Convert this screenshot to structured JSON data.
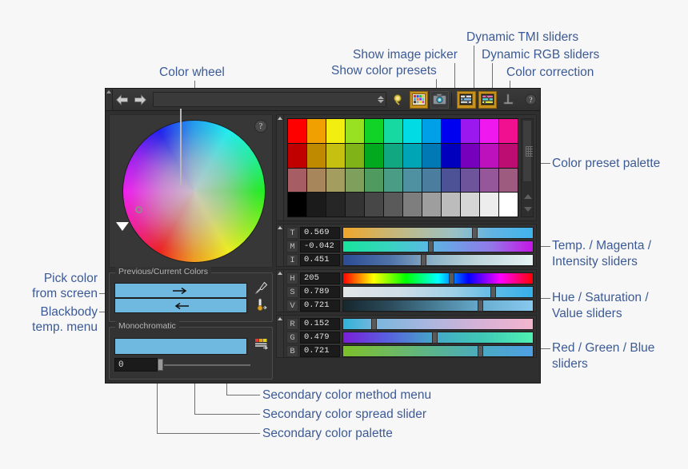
{
  "annotations": {
    "color_wheel": "Color wheel",
    "show_color_presets": "Show color presets",
    "show_image_picker": "Show image picker",
    "dynamic_tmi_sliders": "Dynamic TMI sliders",
    "dynamic_rgb_sliders": "Dynamic RGB sliders",
    "color_correction": "Color correction",
    "color_preset_palette": "Color preset palette",
    "tmi_line1": "Temp. / Magenta /",
    "tmi_line2": "Intensity sliders",
    "hsv_line1": "Hue / Saturation /",
    "hsv_line2": "Value sliders",
    "rgb_line1": "Red / Green / Blue",
    "rgb_line2": "sliders",
    "pick_color_line1": "Pick color",
    "pick_color_line2": "from screen",
    "blackbody_line1": "Blackbody",
    "blackbody_line2": "temp. menu",
    "secondary_method_menu": "Secondary color method menu",
    "secondary_spread_slider": "Secondary color spread slider",
    "secondary_palette": "Secondary color palette"
  },
  "toolbar": {
    "back_icon": "left-arrow-icon",
    "forward_icon": "right-arrow-icon",
    "field_value": "",
    "field_placeholder": "",
    "blackbody_icon": "blackbody-temp-icon",
    "presets_icon": "color-presets-icon",
    "image_picker_icon": "image-picker-icon",
    "tmi_icon": "dynamic-tmi-sliders-icon",
    "rgb_icon": "dynamic-rgb-sliders-icon",
    "correction_icon": "color-correction-icon",
    "help_icon": "help-icon"
  },
  "wheel": {
    "help_label": "?"
  },
  "panels": {
    "previous_current_title": "Previous/Current Colors",
    "monochromatic_title": "Monochromatic",
    "previous_color": "#6fb8e0",
    "current_color": "#6fb8e0",
    "mono_color": "#6fb8e0",
    "spread_value": "0",
    "eyedropper_icon": "eyedropper-icon",
    "thermometer_icon": "thermometer-icon",
    "method_menu_icon": "secondary-color-method-icon"
  },
  "palette": {
    "rows": [
      [
        "#ff0000",
        "#f0a000",
        "#f2ee10",
        "#97e022",
        "#11d227",
        "#15d9a0",
        "#00dbe4",
        "#00a0e8",
        "#0000f0",
        "#9b18ee",
        "#ef18ef",
        "#f01090"
      ],
      [
        "#c00000",
        "#c08a00",
        "#c6c010",
        "#7fb318",
        "#02a81e",
        "#11a881",
        "#00a5b5",
        "#0079b4",
        "#0000bd",
        "#7600bc",
        "#bc11bc",
        "#bd0d73"
      ],
      [
        "#a65e64",
        "#a8865c",
        "#a39e5f",
        "#7fa05d",
        "#4f9a5f",
        "#4b9c85",
        "#4f90a1",
        "#4a7d9e",
        "#4d5296",
        "#6e549a",
        "#96569a",
        "#9c5b7f"
      ],
      [
        "#000000",
        "#1b1b1b",
        "#262626",
        "#343434",
        "#474747",
        "#5a5a5a",
        "#7e7e7e",
        "#9e9e9e",
        "#bcbcbc",
        "#d6d6d6",
        "#ededed",
        "#ffffff"
      ]
    ]
  },
  "sliders": {
    "tmi": [
      {
        "label": "T",
        "value": "0.569",
        "pos": 69,
        "grad": "linear-gradient(90deg,#f0a629 0%,#cdb56d 22%,#b4bd9c 40%,#9cc0c3 58%,#63b4e2 78%,#40b4ec 100%)"
      },
      {
        "label": "M",
        "value": "-0.042",
        "pos": 46,
        "grad": "linear-gradient(90deg,#19e39c 0%,#34d6bb 22%,#56bde0 42%,#6e9fe6 58%,#9278e8 78%,#c616e6 100%)"
      },
      {
        "label": "I",
        "value": "0.451",
        "pos": 42,
        "grad": "linear-gradient(90deg,#2c4c94 0%,#4f73a8 25%,#8fb3c6 48%,#bdd5da 70%,#e6f4f4 100%)"
      }
    ],
    "hsv": [
      {
        "label": "H",
        "value": "205",
        "pos": 57,
        "grad": "linear-gradient(90deg,#ff0000 0%,#ffff00 16%,#00ff00 33%,#00ffff 50%,#0000ff 66%,#ff00ff 83%,#ff0000 100%)"
      },
      {
        "label": "S",
        "value": "0.789",
        "pos": 79,
        "grad": "linear-gradient(90deg,#e2e6e8 0%,#cfdde6 30%,#9ecfe6 58%,#5ebae6 80%,#36b0ea 100%)"
      },
      {
        "label": "V",
        "value": "0.721",
        "pos": 72,
        "grad": "linear-gradient(90deg,#16272e 0%,#2c4c5c 25%,#4a8099 50%,#6bb0d4 75%,#88c9ee 100%)"
      }
    ],
    "rgb": [
      {
        "label": "R",
        "value": "0.152",
        "pos": 16,
        "grad": "linear-gradient(90deg,#2fb3d8 0%,#7cb7de 18%,#aab6df 45%,#d4b2d8 70%,#f3b4cd 100%)"
      },
      {
        "label": "G",
        "value": "0.479",
        "pos": 48,
        "grad": "linear-gradient(90deg,#7a1fd8 0%,#5a5ce0 22%,#45a8c8 48%,#3fc7b6 72%,#4ff0b4 100%)"
      },
      {
        "label": "B",
        "value": "0.721",
        "pos": 72,
        "grad": "linear-gradient(90deg,#7cc02a 0%,#6fba5e 25%,#58b393 50%,#4ba9c4 75%,#4f9fe4 100%)"
      }
    ]
  }
}
